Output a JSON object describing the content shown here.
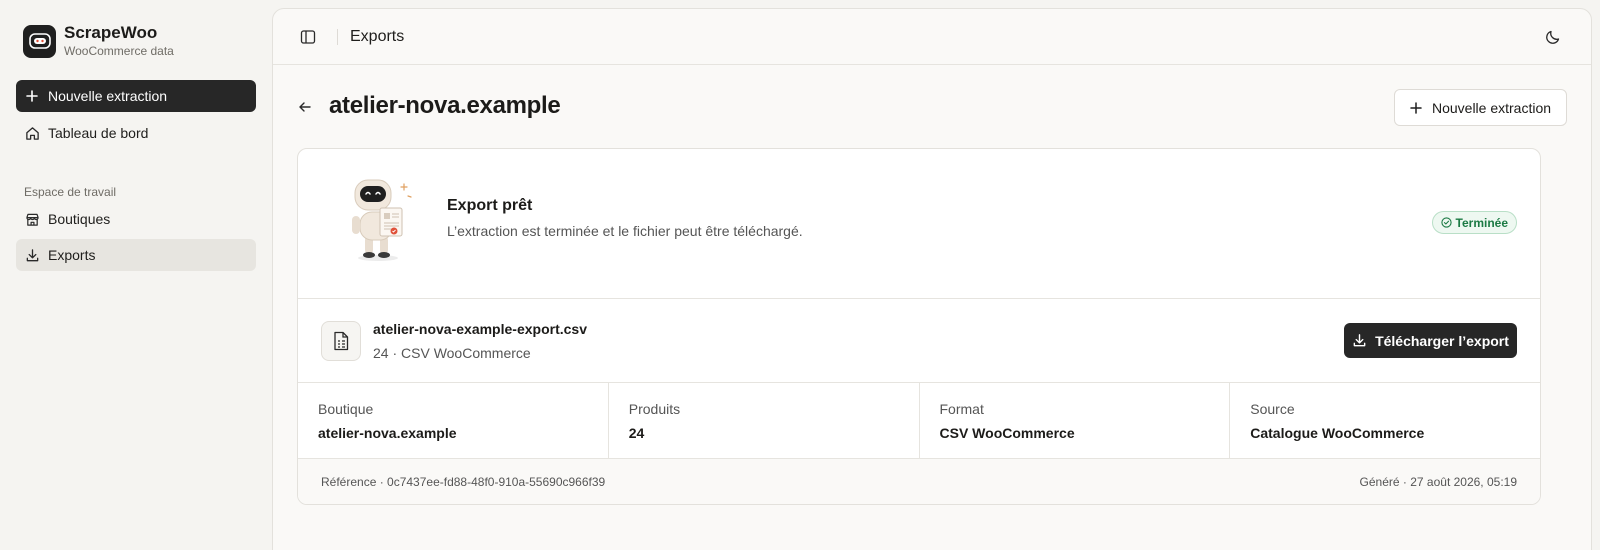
{
  "brand": {
    "name": "ScrapeWoo",
    "subtitle": "WooCommerce data",
    "logo_icon": "robot-face-icon"
  },
  "sidebar": {
    "new_button": "Nouvelle extraction",
    "items": [
      {
        "label": "Tableau de bord",
        "icon": "home-icon"
      }
    ],
    "section_label": "Espace de travail",
    "workspace_items": [
      {
        "label": "Boutiques",
        "icon": "store-icon"
      },
      {
        "label": "Exports",
        "icon": "download-icon",
        "active": true
      }
    ]
  },
  "topbar": {
    "title": "Exports"
  },
  "page": {
    "title": "atelier-nova.example",
    "new_button": "Nouvelle extraction"
  },
  "status": {
    "title": "Export prêt",
    "description": "L’extraction est terminée et le fichier peut être téléchargé.",
    "badge": "Terminée"
  },
  "file": {
    "name": "atelier-nova-example-export.csv",
    "meta": "24 · CSV WooCommerce",
    "download_button": "Télécharger l’export"
  },
  "stats": [
    {
      "label": "Boutique",
      "value": "atelier-nova.example"
    },
    {
      "label": "Produits",
      "value": "24"
    },
    {
      "label": "Format",
      "value": "CSV WooCommerce"
    },
    {
      "label": "Source",
      "value": "Catalogue WooCommerce"
    }
  ],
  "footer": {
    "reference": "Référence · 0c7437ee-fd88-48f0-910a-55690c966f39",
    "generated": "Généré · 27 août 2026, 05:19"
  },
  "colors": {
    "accent_dark": "#272727",
    "success": "#1c7a44",
    "background": "#f5f4f1"
  }
}
